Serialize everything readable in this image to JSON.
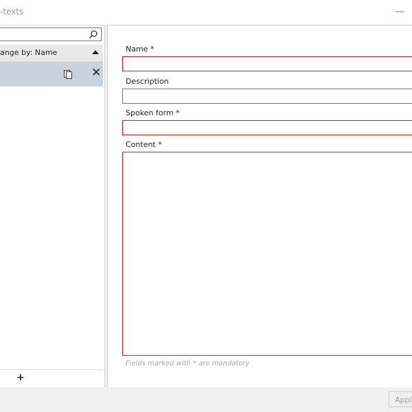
{
  "window": {
    "title": "-texts"
  },
  "left": {
    "arrange_label": "ange by: Name"
  },
  "right": {
    "fields": {
      "name_label": "Name *",
      "description_label": "Description",
      "spoken_label": "Spoken form *",
      "content_label": "Content *"
    },
    "hint": "Fields marked with * are mandatory"
  },
  "footer": {
    "apply_label": "Appl"
  },
  "colors": {
    "required_border": "#e81123",
    "selected_item": "#c9d3e0"
  }
}
